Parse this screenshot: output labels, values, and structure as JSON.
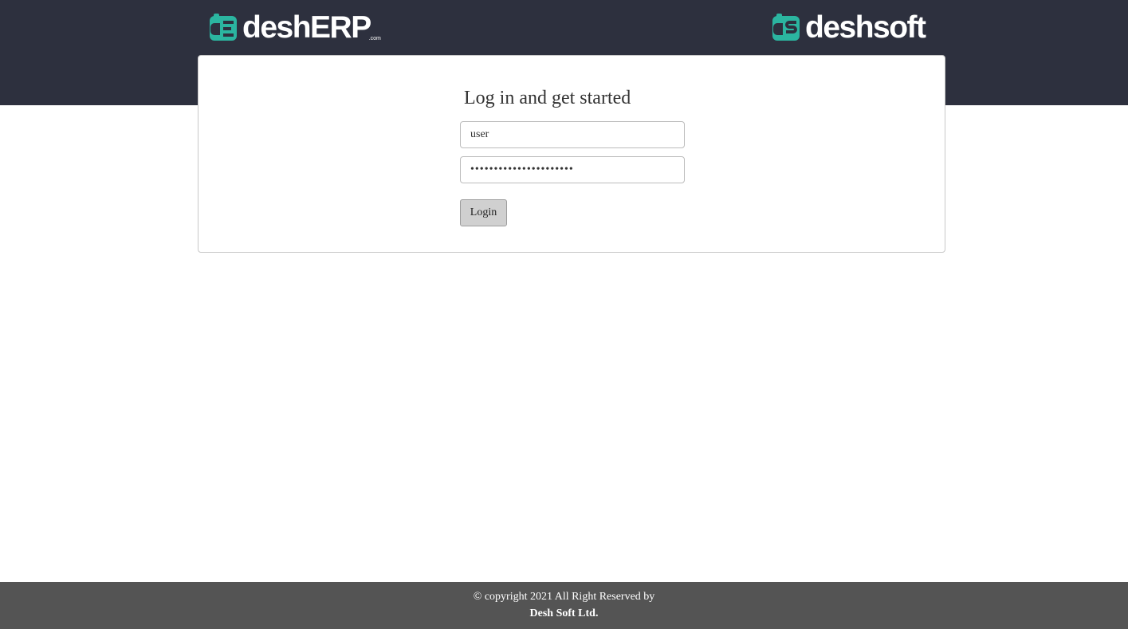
{
  "header": {
    "left_logo": {
      "text": "deshERP",
      "suffix": ".com",
      "mark_letters": "dE",
      "icon": "desherp-logo-icon",
      "accent_color": "#2bb5a0"
    },
    "right_logo": {
      "text": "deshsoft",
      "mark_letters": "ds",
      "icon": "deshsoft-logo-icon",
      "accent_color": "#2bb5a0"
    },
    "background_color": "#2d303e"
  },
  "login": {
    "title": "Log in and get started",
    "username_value": "user",
    "password_value": "••••••••••••••••••••••",
    "login_label": "Login"
  },
  "footer": {
    "copyright": "© copyright 2021 All Right Reserved by",
    "company": "Desh Soft Ltd.",
    "background_color": "#545454"
  }
}
